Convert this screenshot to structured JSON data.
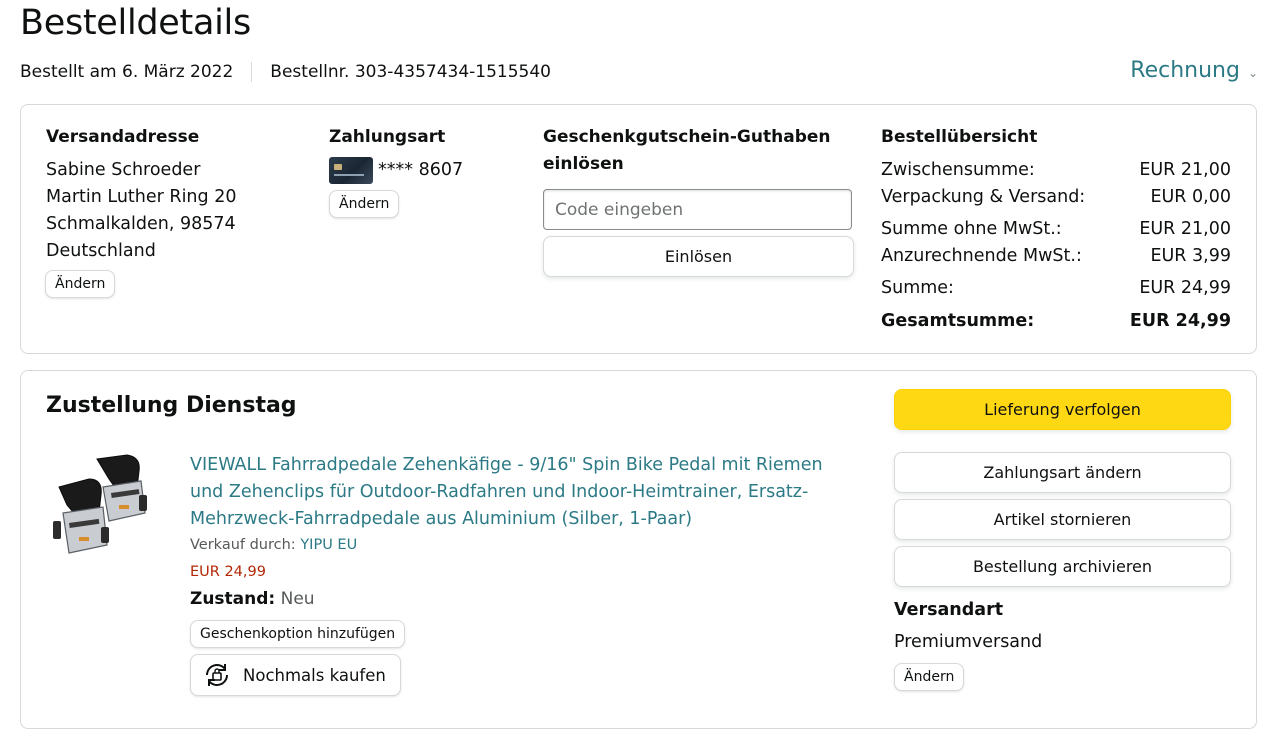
{
  "header": {
    "title": "Bestelldetails",
    "ordered_on": "Bestellt am 6. März 2022",
    "order_number": "Bestellnr. 303-4357434-1515540",
    "invoice_label": "Rechnung"
  },
  "shipping_address": {
    "heading": "Versandadresse",
    "lines": [
      "Sabine Schroeder",
      "Martin Luther Ring 20",
      "Schmalkalden, 98574",
      "Deutschland"
    ],
    "change_label": "Ändern"
  },
  "payment": {
    "heading": "Zahlungsart",
    "card_masked": "**** 8607",
    "card_icon": "credit-card-icon",
    "change_label": "Ändern"
  },
  "gift_card": {
    "heading_line1": "Geschenkgutschein-Guthaben",
    "heading_line2": "einlösen",
    "placeholder": "Code eingeben",
    "redeem_label": "Einlösen"
  },
  "order_summary": {
    "heading": "Bestellübersicht",
    "rows": [
      {
        "label": "Zwischensumme:",
        "value": "EUR 21,00"
      },
      {
        "label": "Verpackung & Versand:",
        "value": "EUR 0,00"
      },
      {
        "label": "Summe ohne MwSt.:",
        "value": "EUR 21,00"
      },
      {
        "label": "Anzurechnende MwSt.:",
        "value": "EUR 3,99"
      },
      {
        "label": "Summe:",
        "value": "EUR 24,99"
      }
    ],
    "total_label": "Gesamtsumme:",
    "total_value": "EUR 24,99"
  },
  "delivery": {
    "heading": "Zustellung Dienstag",
    "product": {
      "title": "VIEWALL Fahrradpedale Zehenkäfige - 9/16\" Spin Bike Pedal mit Riemen und Zehenclips für Outdoor-Radfahren und Indoor-Heimtrainer, Ersatz-Mehrzweck-Fahrradpedale aus Aluminium (Silber, 1-Paar)",
      "sold_by_label": "Verkauf durch:",
      "seller": "YIPU EU",
      "price": "EUR 24,99",
      "condition_label": "Zustand:",
      "condition_value": "Neu",
      "gift_option_label": "Geschenkoption hinzufügen",
      "buy_again_label": "Nochmals kaufen",
      "image": "bike-pedal-product-image"
    },
    "actions": {
      "track": "Lieferung verfolgen",
      "change_payment": "Zahlungsart ändern",
      "cancel": "Artikel stornieren",
      "archive": "Bestellung archivieren"
    },
    "shipping_method": {
      "heading": "Versandart",
      "value": "Premiumversand",
      "change_label": "Ändern"
    }
  },
  "colors": {
    "link": "#2c7a86",
    "price": "#b12704",
    "primary_button": "#ffd814",
    "border": "#d5d9d9"
  }
}
